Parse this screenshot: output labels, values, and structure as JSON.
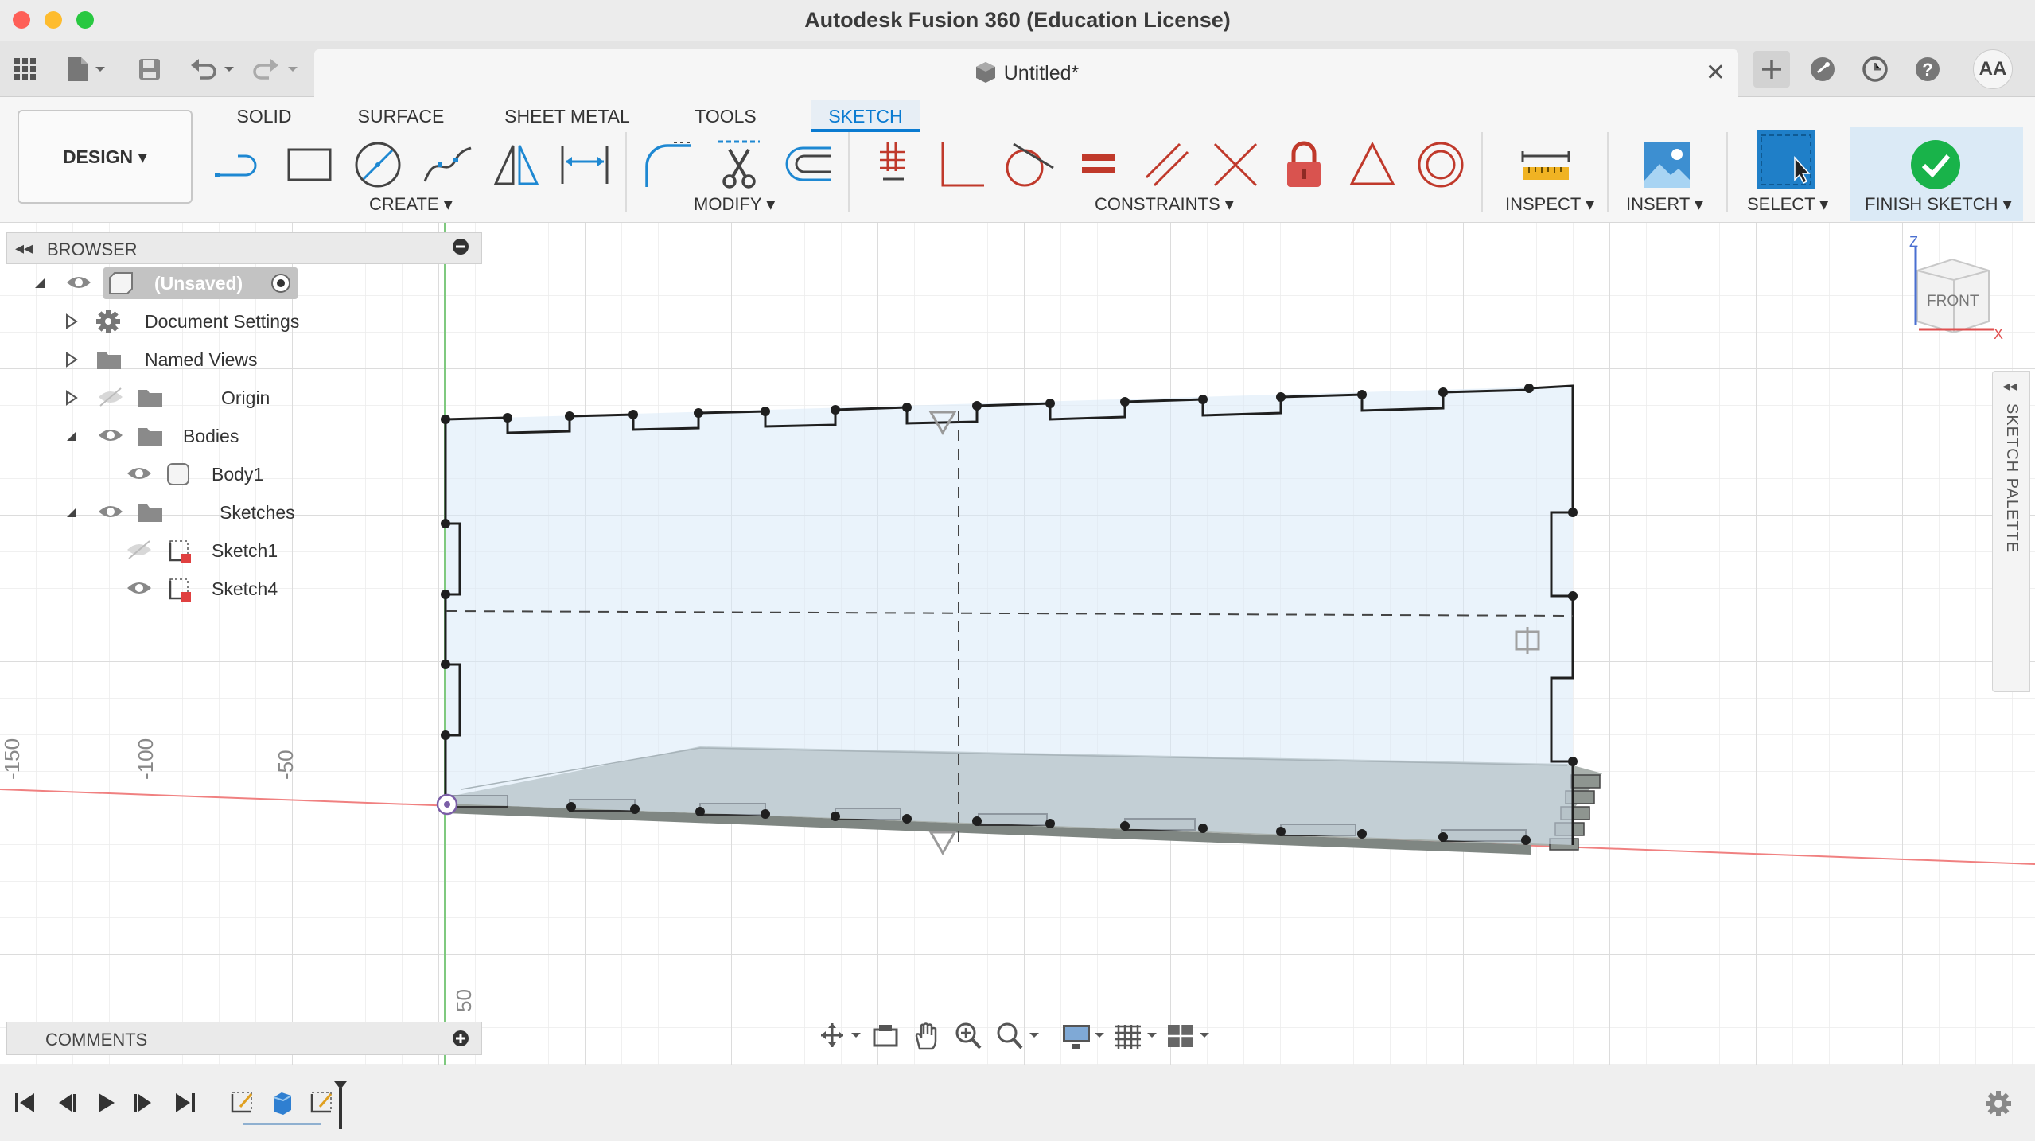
{
  "window": {
    "title": "Autodesk Fusion 360 (Education License)"
  },
  "document_tab": {
    "title": "Untitled*",
    "close_glyph": "✕"
  },
  "user": {
    "initials": "AA"
  },
  "workspace_tabs": [
    "SOLID",
    "SURFACE",
    "SHEET METAL",
    "TOOLS",
    "SKETCH"
  ],
  "active_tab": "SKETCH",
  "design_button": "DESIGN ▾",
  "groups": {
    "create": "CREATE ▾",
    "modify": "MODIFY ▾",
    "constraints": "CONSTRAINTS ▾",
    "inspect": "INSPECT ▾",
    "insert": "INSERT ▾",
    "select": "SELECT ▾",
    "finish": "FINISH SKETCH ▾"
  },
  "browser": {
    "title": "BROWSER",
    "root": "(Unsaved)",
    "items": [
      {
        "label": "Document Settings"
      },
      {
        "label": "Named Views"
      },
      {
        "label": "Origin"
      },
      {
        "label": "Bodies"
      },
      {
        "label": "Body1"
      },
      {
        "label": "Sketches"
      },
      {
        "label": "Sketch1"
      },
      {
        "label": "Sketch4"
      }
    ]
  },
  "comments": {
    "title": "COMMENTS"
  },
  "sketch_palette": {
    "title": "SKETCH PALETTE"
  },
  "viewcube": {
    "face": "FRONT",
    "axis_z": "Z",
    "axis_x": "X"
  },
  "ruler_labels": [
    "-150",
    "-100",
    "-50",
    "50"
  ],
  "colors": {
    "accent": "#0a7bd1",
    "finish": "#19b34a",
    "axis_red": "#f08080",
    "axis_green": "#7fc97f"
  }
}
